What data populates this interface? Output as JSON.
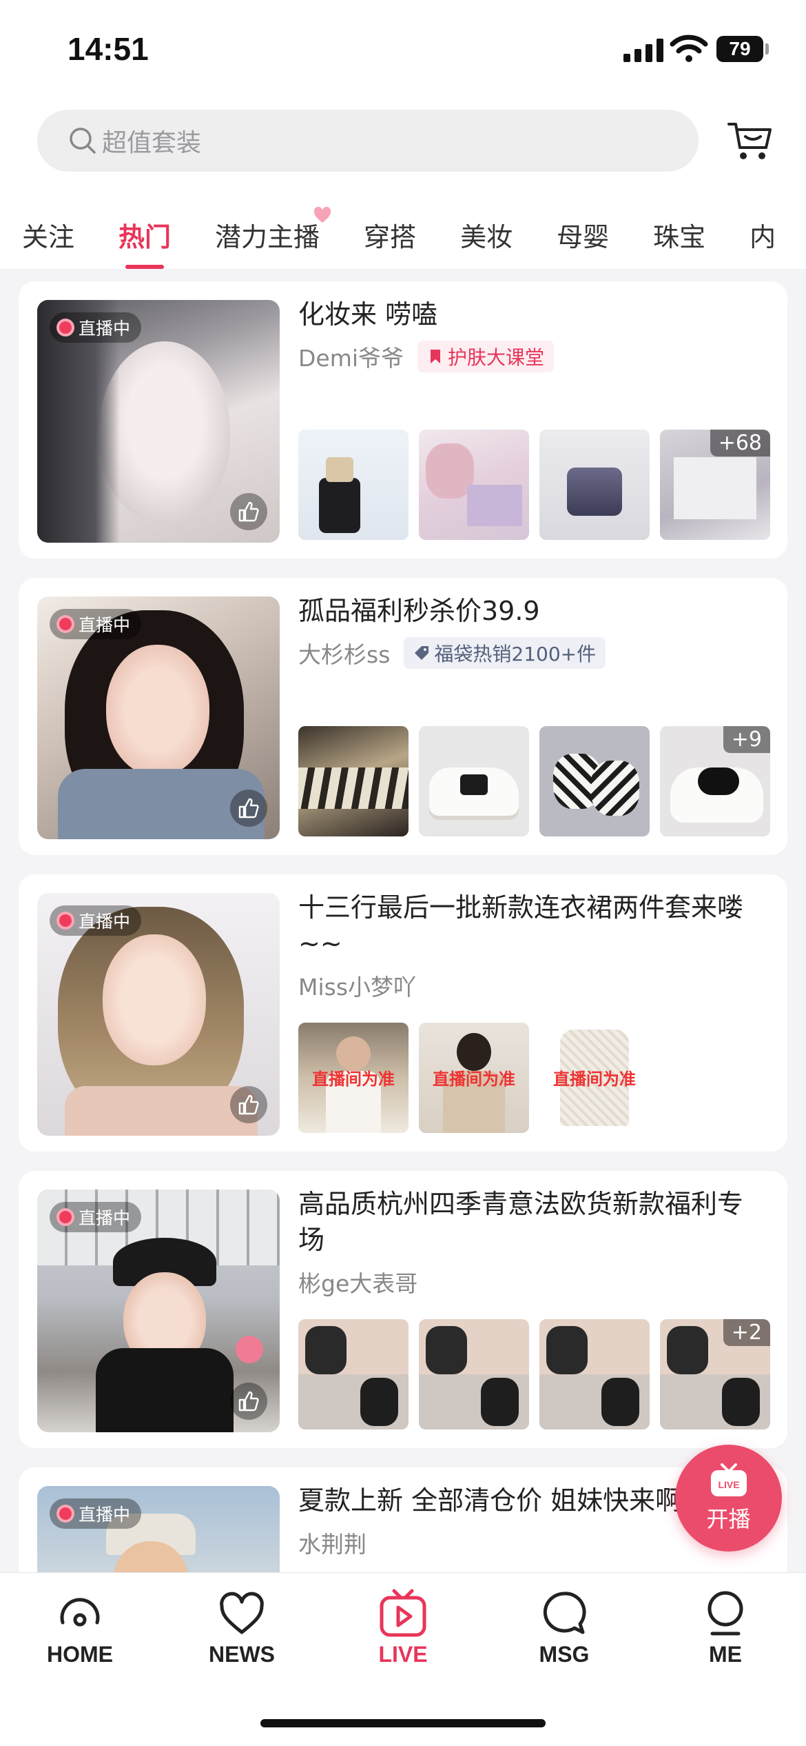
{
  "status_bar": {
    "time": "14:51",
    "battery": "79"
  },
  "search": {
    "placeholder": "超值套装"
  },
  "tabs": [
    "关注",
    "热门",
    "潜力主播",
    "穿搭",
    "美妆",
    "母婴",
    "珠宝",
    "内"
  ],
  "active_tab": "热门",
  "live_badge": "直播中",
  "cards": [
    {
      "title": "化妆来 唠嗑",
      "host": "Demi爷爷",
      "tag": "护肤大课堂",
      "tag_style": "pink",
      "more": "+68"
    },
    {
      "title": "孤品福利秒杀价39.9",
      "host": "大杉杉ss",
      "tag": "福袋热销2100+件",
      "tag_style": "blue",
      "more": "+9"
    },
    {
      "title": "十三行最后一批新款连衣裙两件套来喽~~",
      "host": "Miss小梦吖",
      "product_caption": "直播间为准"
    },
    {
      "title": "高品质杭州四季青意法欧货新款福利专场",
      "host": "彬ge大表哥",
      "more": "+2"
    },
    {
      "title": "夏款上新 全部清仓价 姐妹快来啊",
      "host": "水荆荆"
    }
  ],
  "start_live": {
    "label": "开播",
    "icon_text": "LIVE"
  },
  "nav": [
    {
      "label": "HOME",
      "icon": "home-icon"
    },
    {
      "label": "NEWS",
      "icon": "heart-icon"
    },
    {
      "label": "LIVE",
      "icon": "tv-play-icon"
    },
    {
      "label": "MSG",
      "icon": "chat-bubble-icon"
    },
    {
      "label": "ME",
      "icon": "person-icon"
    }
  ],
  "colors": {
    "accent": "#e8355a",
    "start_live": "#ec4c6b"
  }
}
